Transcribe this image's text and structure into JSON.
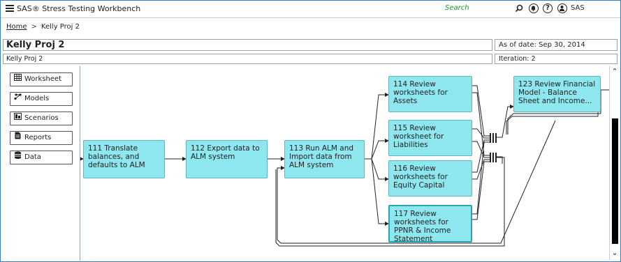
{
  "app": {
    "title": "SAS® Stress Testing Workbench",
    "search_label": "Search",
    "user_label": "SAS"
  },
  "breadcrumb": {
    "home": "Home",
    "separator": ">",
    "current": "Kelly Proj 2"
  },
  "project": {
    "title": "Kelly Proj 2",
    "as_of": "As of date: Sep 30, 2014",
    "subtitle": "Kelly Proj 2",
    "iteration": "Iteration: 2"
  },
  "sidebar": {
    "items": [
      {
        "label": "Worksheet",
        "icon": "worksheet-icon"
      },
      {
        "label": "Models",
        "icon": "models-icon"
      },
      {
        "label": "Scenarios",
        "icon": "scenarios-icon"
      },
      {
        "label": "Reports",
        "icon": "reports-icon"
      },
      {
        "label": "Data",
        "icon": "data-icon"
      }
    ]
  },
  "workflow": {
    "nodes": [
      {
        "id": "111",
        "label": "111 Translate balances, and defaults to ALM"
      },
      {
        "id": "112",
        "label": "112 Export data to ALM system"
      },
      {
        "id": "113",
        "label": "113 Run ALM and Import data from ALM system"
      },
      {
        "id": "114",
        "label": "114 Review worksheets for Assets"
      },
      {
        "id": "115",
        "label": "115 Review worksheet for Liabilities"
      },
      {
        "id": "116",
        "label": "116 Review worksheets for Equity Capital"
      },
      {
        "id": "117",
        "label": "117 Review worksheets for PPNR & Income Statement",
        "selected": true
      },
      {
        "id": "123",
        "label": "123 Review Financial Model - Balance Sheet and Income..."
      }
    ]
  },
  "colors": {
    "node_fill": "#8ee6ee",
    "node_border": "#5cb6c4",
    "selected_border": "#2aa6b0",
    "search": "#1f8f3a",
    "frame": "#3a7fc1"
  }
}
